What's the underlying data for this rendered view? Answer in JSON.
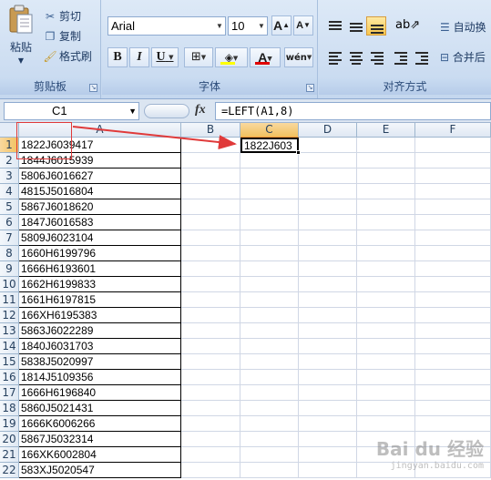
{
  "ribbon": {
    "clipboard": {
      "paste_label": "粘贴",
      "cut_label": "剪切",
      "copy_label": "复制",
      "format_painter_label": "格式刷",
      "group_label": "剪贴板"
    },
    "font": {
      "font_name": "Arial",
      "font_size": "10",
      "grow_font": "A",
      "shrink_font": "A",
      "bold": "B",
      "italic": "I",
      "underline": "U",
      "phonetic": "wén",
      "group_label": "字体",
      "font_color": "#e00000",
      "fill_color": "#ffff00"
    },
    "alignment": {
      "wrap_text_label": "自动换",
      "merge_center_label": "合并后",
      "group_label": "对齐方式"
    }
  },
  "formula_bar": {
    "name_box": "C1",
    "fx": "fx",
    "formula": "=LEFT(A1,8)"
  },
  "grid": {
    "columns": [
      "A",
      "B",
      "C",
      "D",
      "E",
      "F"
    ],
    "active_column": "C",
    "active_row": "1",
    "rows": [
      "1",
      "2",
      "3",
      "4",
      "5",
      "6",
      "7",
      "8",
      "9",
      "10",
      "11",
      "12",
      "13",
      "14",
      "15",
      "16",
      "17",
      "18",
      "19",
      "20",
      "21",
      "22"
    ],
    "column_a": [
      "1822J6039417",
      "1844J6015939",
      "5806J6016627",
      "4815J5016804",
      "5867J6018620",
      "1847J6016583",
      "5809J6023104",
      "1660H6199796",
      "1666H6193601",
      "1662H6199833",
      "1661H6197815",
      "166XH6195383",
      "5863J6022289",
      "1840J6031703",
      "5838J5020997",
      "1814J5109356",
      "1666H6196840",
      "5860J5021431",
      "1666K6006266",
      "5867J5032314",
      "166XK6002804",
      "583XJ5020547"
    ],
    "c1_value": "1822J603"
  },
  "annotation": {
    "color": "#e03a3a"
  },
  "watermark": {
    "main": "Bai du 经验",
    "sub": "jingyan.baidu.com"
  }
}
